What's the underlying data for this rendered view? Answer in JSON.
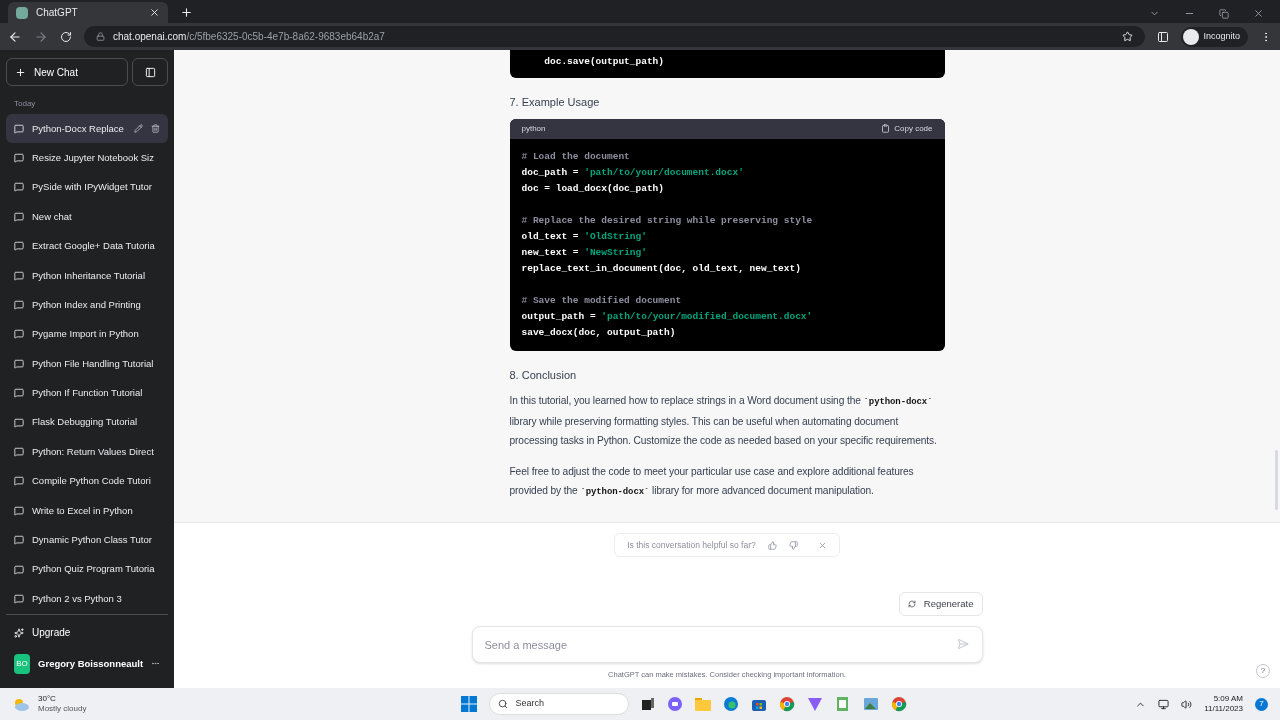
{
  "browser": {
    "tab_title": "ChatGPT",
    "url_host": "chat.openai.com",
    "url_path": "/c/5fbe6325-0c5b-4e7b-8a62-9683eb64b2a7",
    "profile": "Incognito"
  },
  "sidebar": {
    "new_chat": "New Chat",
    "section": "Today",
    "items": [
      {
        "title": "Python-Docx Replace",
        "selected": true
      },
      {
        "title": "Resize Jupyter Notebook Siz",
        "selected": false
      },
      {
        "title": "PySide with IPyWidget Tutor",
        "selected": false
      },
      {
        "title": "New chat",
        "selected": false
      },
      {
        "title": "Extract Google+ Data Tutoria",
        "selected": false
      },
      {
        "title": "Python Inheritance Tutorial",
        "selected": false
      },
      {
        "title": "Python Index and Printing",
        "selected": false
      },
      {
        "title": "Pygame Import in Python",
        "selected": false
      },
      {
        "title": "Python File Handling Tutorial",
        "selected": false
      },
      {
        "title": "Python If Function Tutorial",
        "selected": false
      },
      {
        "title": "Flask Debugging Tutorial",
        "selected": false
      },
      {
        "title": "Python: Return Values Direct",
        "selected": false
      },
      {
        "title": "Compile Python Code Tutori",
        "selected": false
      },
      {
        "title": "Write to Excel in Python",
        "selected": false
      },
      {
        "title": "Dynamic Python Class Tutor",
        "selected": false
      },
      {
        "title": "Python Quiz Program Tutoria",
        "selected": false
      },
      {
        "title": "Python 2 vs Python 3",
        "selected": false
      }
    ],
    "upgrade": "Upgrade",
    "user": {
      "initials": "BO",
      "name": "Gregory Boissonneault"
    }
  },
  "blocks": [
    {
      "kind": "code",
      "groups": [
        [
          [
            {
              "t": "    doc.save(output_path)",
              "kind": "plain"
            }
          ]
        ]
      ]
    },
    {
      "kind": "heading",
      "text": "7. Example Usage"
    },
    {
      "kind": "code",
      "language": "python",
      "copy_label": "Copy code",
      "groups": [
        [
          [
            {
              "t": "# Load the document",
              "kind": "comment"
            }
          ],
          [
            {
              "t": "doc_path = ",
              "kind": "plain"
            },
            {
              "t": "'path/to/your/document.docx'",
              "kind": "string"
            }
          ],
          [
            {
              "t": "doc = load_docx(doc_path)",
              "kind": "plain"
            }
          ]
        ],
        [
          [
            {
              "t": "# Replace the desired string while preserving style",
              "kind": "comment"
            }
          ],
          [
            {
              "t": "old_text = ",
              "kind": "plain"
            },
            {
              "t": "'OldString'",
              "kind": "string"
            }
          ],
          [
            {
              "t": "new_text = ",
              "kind": "plain"
            },
            {
              "t": "'NewString'",
              "kind": "string"
            }
          ],
          [
            {
              "t": "replace_text_in_document(doc, old_text, new_text)",
              "kind": "plain"
            }
          ]
        ],
        [
          [
            {
              "t": "# Save the modified document",
              "kind": "comment"
            }
          ],
          [
            {
              "t": "output_path = ",
              "kind": "plain"
            },
            {
              "t": "'path/to/your/modified_document.docx'",
              "kind": "string"
            }
          ],
          [
            {
              "t": "save_docx(doc, output_path)",
              "kind": "plain"
            }
          ]
        ]
      ]
    },
    {
      "kind": "heading",
      "text": "8. Conclusion"
    },
    {
      "kind": "paragraph",
      "parts": [
        {
          "t": "In this tutorial, you learned how to replace strings in a Word document using the ",
          "kind": "text"
        },
        {
          "t": "`python-docx`",
          "kind": "code"
        },
        {
          "t": " library while preserving formatting styles. This can be useful when automating document processing tasks in Python. Customize the code as needed based on your specific requirements.",
          "kind": "text"
        }
      ]
    },
    {
      "kind": "paragraph",
      "parts": [
        {
          "t": "Feel free to adjust the code to meet your particular use case and explore additional features provided by the ",
          "kind": "text"
        },
        {
          "t": "`python-docx`",
          "kind": "code"
        },
        {
          "t": " library for more advanced document manipulation.",
          "kind": "text"
        }
      ]
    }
  ],
  "feedback": {
    "question": "Is this conversation helpful so far?"
  },
  "regenerate": "Regenerate",
  "composer": {
    "placeholder": "Send a message"
  },
  "disclaimer": "ChatGPT can make mistakes. Consider checking important information.",
  "help": "?",
  "taskbar": {
    "weather_temp": "30°C",
    "weather_desc": "Mostly cloudy",
    "search": "Search",
    "time": "5:09 AM",
    "date": "11/11/2023",
    "notification_count": "7"
  }
}
